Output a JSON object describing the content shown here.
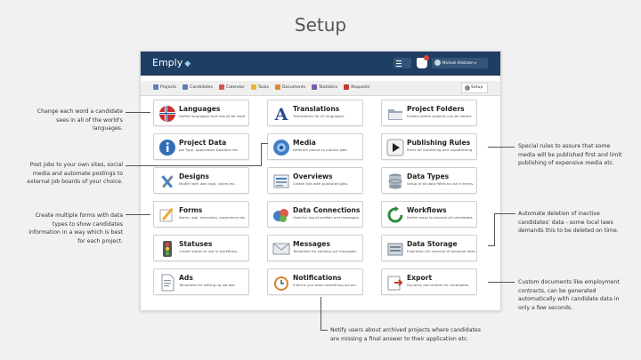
{
  "slide_title": "Setup",
  "app": {
    "logo": "Emply",
    "user_name": "Michael Ahlstrøm",
    "tabs": [
      "Projects",
      "Candidates",
      "Calendar",
      "Tasks",
      "Documents",
      "Statistics",
      "Requests"
    ],
    "tab_colors": [
      "#5a7fb5",
      "#5a7fb5",
      "#d9534f",
      "#e8b92e",
      "#d98b2b",
      "#7a5aa8",
      "#c0392b"
    ],
    "active_tab": "Setup"
  },
  "cards": [
    {
      "title": "Languages",
      "desc": "Define languages that should be used.",
      "icon": "flag-globe-icon"
    },
    {
      "title": "Translations",
      "desc": "Translations for all languages.",
      "icon": "letter-a-icon"
    },
    {
      "title": "Project Folders",
      "desc": "Folders where projects can be stored.",
      "icon": "folder-icon"
    },
    {
      "title": "Project Data",
      "desc": "Job Type, Application Deadline etc.",
      "icon": "info-icon"
    },
    {
      "title": "Media",
      "desc": "Different places to publish jobs.",
      "icon": "media-icon"
    },
    {
      "title": "Publishing Rules",
      "desc": "Rules for publishing and unpublishing.",
      "icon": "play-icon"
    },
    {
      "title": "Designs",
      "desc": "Modify with own logo, colors etc.",
      "icon": "tools-icon"
    },
    {
      "title": "Overviews",
      "desc": "Create lists with published jobs.",
      "icon": "overview-icon"
    },
    {
      "title": "Data Types",
      "desc": "Setup of all data fields to use in forms.",
      "icon": "database-icon"
    },
    {
      "title": "Forms",
      "desc": "Name, age, education, experience etc.",
      "icon": "pencil-icon"
    },
    {
      "title": "Data Connections",
      "desc": "Used for top of profiles and messages.",
      "icon": "connections-icon"
    },
    {
      "title": "Workflows",
      "desc": "Define ways to process all candidates.",
      "icon": "refresh-icon"
    },
    {
      "title": "Statuses",
      "desc": "Create status to use in workflows.",
      "icon": "traffic-light-icon"
    },
    {
      "title": "Messages",
      "desc": "Templates for sending out messages.",
      "icon": "envelope-icon"
    },
    {
      "title": "Data Storage",
      "desc": "Expiration for removal of personal data.",
      "icon": "storage-icon"
    },
    {
      "title": "Ads",
      "desc": "Templates for setting up job ads.",
      "icon": "document-icon"
    },
    {
      "title": "Notifications",
      "desc": "Informs you when something occurs.",
      "icon": "alarm-clock-icon"
    },
    {
      "title": "Export",
      "desc": "Dynamic documents for candidates.",
      "icon": "export-icon"
    }
  ],
  "notes": {
    "languages": "Change each word a candidate sees in all of the world's languages.",
    "media": "Post jobs to your own sites, social media and automate postings to external job boards of your choice.",
    "forms": "Create multiple forms with data types to show candidates information in a way which is best for each project.",
    "publishing": "Special rules to assure that some media will be published first and limit publishing of expensive media etc.",
    "data_storage": "Automate deletion of inactive candidates' data - some local laws demands this to be deleted on time.",
    "export": "Custom documents like employment contracts, can be generated automatically with candidate data in only a few seconds.",
    "notifications": "Notify users about archived projects where candidates are missing a final answer to their application etc."
  }
}
